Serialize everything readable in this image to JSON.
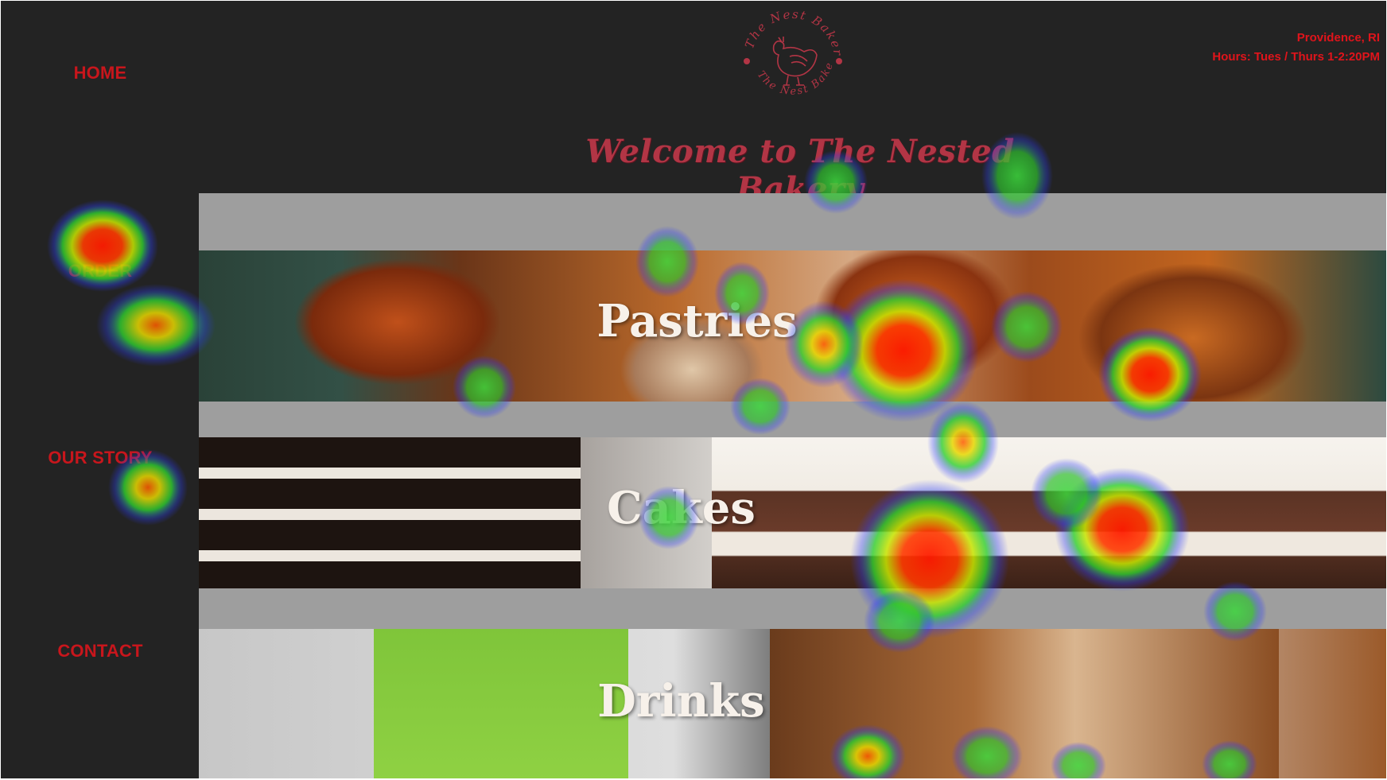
{
  "nav": {
    "home": "HOME",
    "order": "ORDER",
    "our_story": "OUR STORY",
    "contact": "CONTACT"
  },
  "header": {
    "location": "Providence, RI",
    "hours": "Hours: Tues / Thurs 1-2:20PM",
    "logo_text_top": "The Nest Bakery",
    "logo_text_bottom": "The Nest Bakery",
    "welcome": "Welcome to The Nested Bakery"
  },
  "categories": [
    {
      "label": "Pastries"
    },
    {
      "label": "Cakes"
    },
    {
      "label": "Drinks"
    }
  ],
  "colors": {
    "background": "#232323",
    "accent_red": "#c8161c",
    "welcome_pink": "#b23545",
    "band_gap": "#9e9e9e"
  },
  "icons": {
    "logo": "hen-icon"
  },
  "heatmap": {
    "type": "gaze-heatmap",
    "description_levels": [
      "red",
      "yellow",
      "green",
      "blue"
    ]
  }
}
